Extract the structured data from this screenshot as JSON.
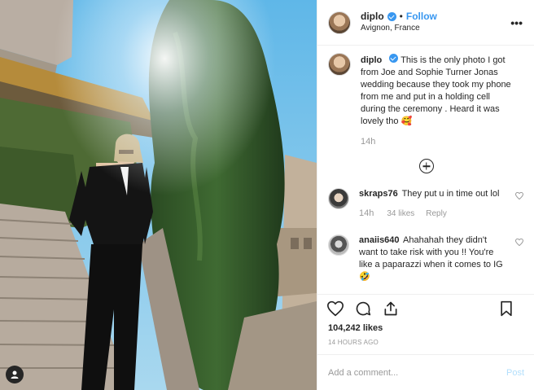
{
  "header": {
    "username": "diplo",
    "separator": "•",
    "follow_label": "Follow",
    "location": "Avignon, France",
    "more_label": "•••"
  },
  "caption": {
    "username": "diplo",
    "text": "This is the only photo I got from Joe and Sophie Turner Jonas wedding because they took my phone from me and put in a holding cell during the ceremony . Heard it was lovely tho 🥰",
    "time": "14h"
  },
  "comments": [
    {
      "username": "skraps76",
      "text": "They put u in time out lol",
      "time": "14h",
      "likes": "34 likes",
      "reply_label": "Reply"
    },
    {
      "username": "anaiis640",
      "text": "Ahahahah they didn't want to take risk with you !! You're like a paparazzi when it comes to IG 🤣"
    }
  ],
  "stats": {
    "likes": "104,242 likes",
    "posted": "14 HOURS AGO"
  },
  "add_comment": {
    "placeholder": "Add a comment...",
    "post_label": "Post"
  },
  "colors": {
    "accent": "#3897f0",
    "post_disabled": "#b2dffc",
    "muted": "#999999",
    "text": "#262626"
  },
  "icons": [
    "verified-badge-icon",
    "load-more-icon",
    "heart-icon",
    "comment-icon",
    "share-icon",
    "bookmark-icon",
    "user-tag-icon"
  ]
}
